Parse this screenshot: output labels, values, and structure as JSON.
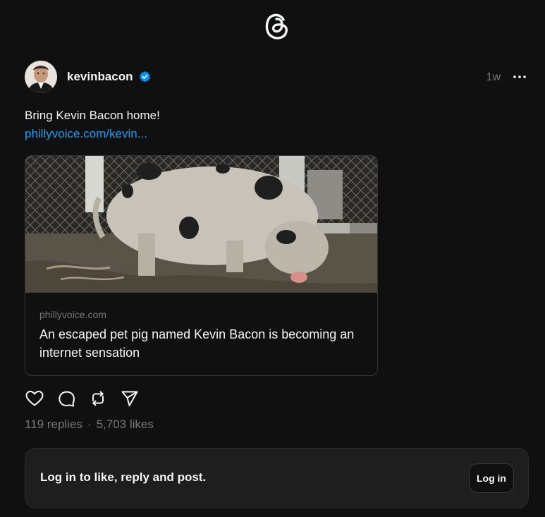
{
  "app": {
    "logo_icon": "threads-logo-icon"
  },
  "post": {
    "username": "kevinbacon",
    "verified_icon": "verified-badge-icon",
    "timestamp": "1w",
    "more_icon": "more-dots-icon",
    "text": "Bring Kevin Bacon home!",
    "link_text": "phillyvoice.com/kevin...",
    "link_card": {
      "domain": "phillyvoice.com",
      "title": "An escaped pet pig named Kevin Bacon is becoming an internet sensation"
    },
    "actions": {
      "like_icon": "heart-icon",
      "reply_icon": "comment-icon",
      "repost_icon": "repost-icon",
      "share_icon": "send-icon"
    },
    "stats": {
      "replies": "119 replies",
      "separator": "·",
      "likes": "5,703 likes"
    }
  },
  "login_prompt": {
    "text": "Log in to like, reply and post.",
    "button_label": "Log in"
  },
  "colors": {
    "background": "#101010",
    "link": "#1d9bf0",
    "verified": "#0095f6",
    "muted": "#777777"
  }
}
